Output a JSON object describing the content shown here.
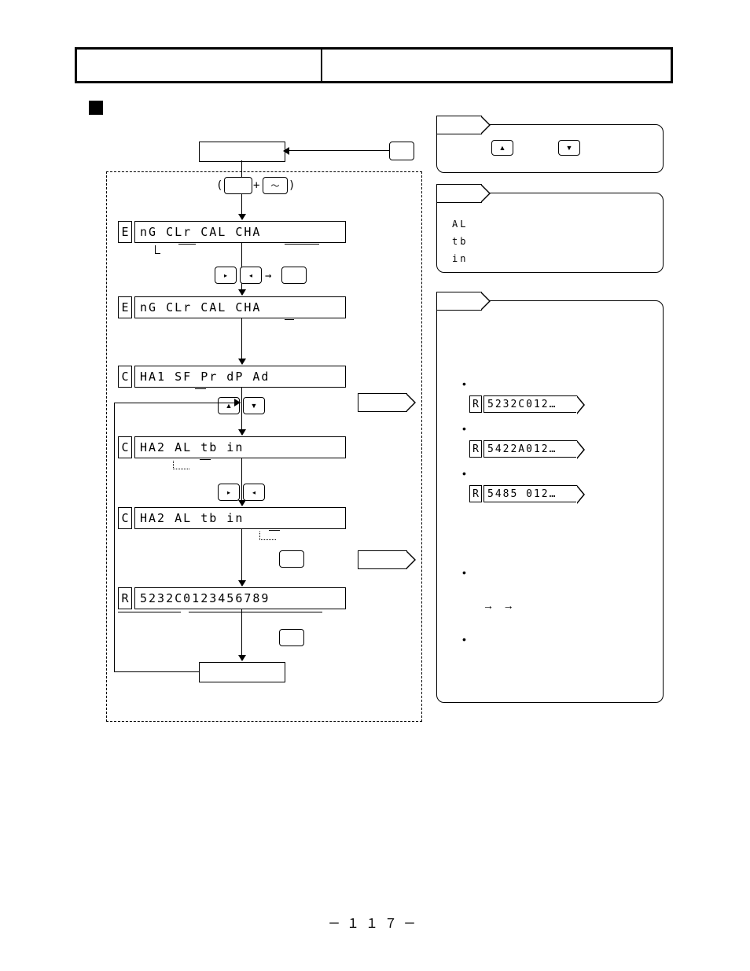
{
  "page_number": "－１１７－",
  "lcd_rows": [
    {
      "prefix": "E",
      "text": "nG   CLr  CAL  CHA"
    },
    {
      "prefix": "E",
      "text": "nG   CLr  CAL  CHA"
    },
    {
      "prefix": "C",
      "text": "HA1  SF Pr  dP  Ad"
    },
    {
      "prefix": "C",
      "text": "HA2   AL  tb  in"
    },
    {
      "prefix": "C",
      "text": "HA2   AL  tb  in"
    },
    {
      "prefix": "R",
      "text": "5232C0123456789"
    }
  ],
  "note2_text": [
    "AL",
    "tb",
    "in"
  ],
  "small_lcds": [
    {
      "prefix": "R",
      "text": "5232C012…"
    },
    {
      "prefix": "R",
      "text": "5422A012…"
    },
    {
      "prefix": "R",
      "text": "5485 012…"
    }
  ],
  "tilde": "～",
  "plus": "+",
  "paren_open": "(",
  "paren_close": ")",
  "arrow_right": "→",
  "triangle_up": "▲",
  "triangle_down": "▼",
  "triangle_right": "▸",
  "triangle_left": "◂"
}
